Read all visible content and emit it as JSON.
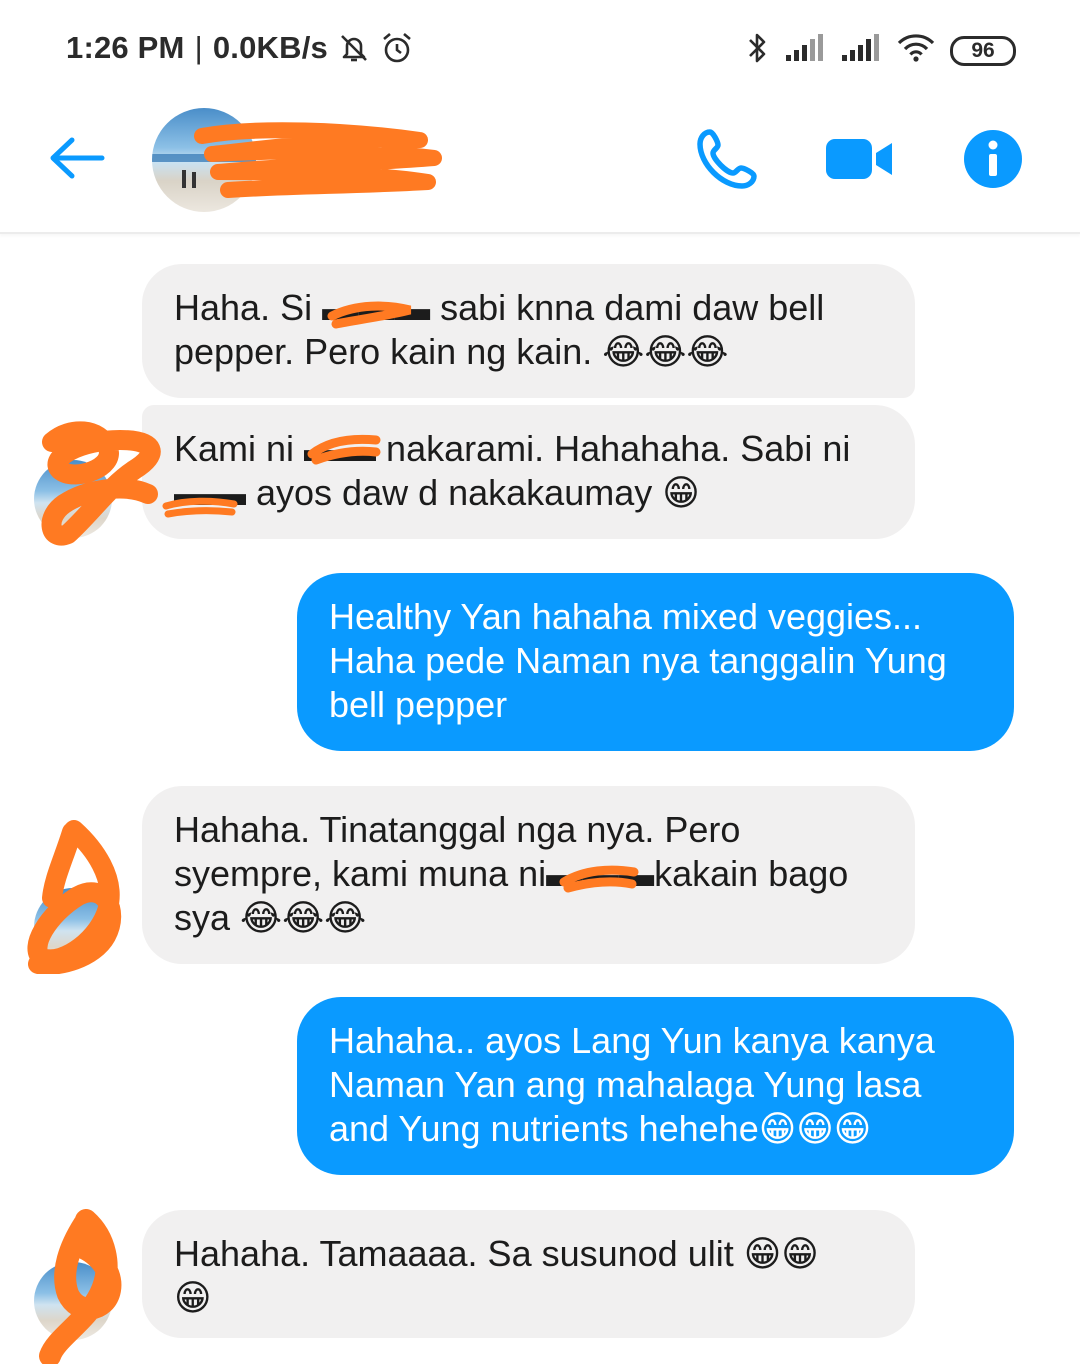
{
  "status_bar": {
    "time": "1:26 PM",
    "separator": "|",
    "network_speed": "0.0KB/s",
    "battery": "96",
    "icons": [
      "mute-bell-icon",
      "alarm-icon",
      "bluetooth-icon",
      "signal-icon",
      "signal-icon",
      "wifi-icon",
      "battery-icon"
    ]
  },
  "header": {
    "icons": [
      "back-arrow-icon",
      "phone-icon",
      "video-camera-icon",
      "info-icon"
    ],
    "accent_color": "#0a9aff"
  },
  "messages": [
    {
      "direction": "incoming",
      "lines": [
        "Haha. Si ▬▬▬ sabi knna dami daw bell",
        "pepper. Pero kain ng kain. 😂😂😂"
      ]
    },
    {
      "direction": "incoming",
      "lines": [
        "Kami ni ▬▬ nakarami. Hahahaha. Sabi ni",
        "▬▬ ayos daw d nakakaumay 😁"
      ]
    },
    {
      "direction": "outgoing",
      "lines": [
        "Healthy Yan hahaha mixed veggies...",
        "Haha pede Naman nya tanggalin Yung",
        "bell pepper"
      ]
    },
    {
      "direction": "incoming",
      "lines": [
        "Hahaha. Tinatanggal nga nya. Pero",
        "syempre, kami muna ni▬▬▬kakain bago",
        "sya 😂😂😂"
      ]
    },
    {
      "direction": "outgoing",
      "lines": [
        "Hahaha.. ayos Lang Yun kanya kanya",
        "Naman Yan ang mahalaga Yung lasa",
        "and Yung nutrients hehehe😁😁😁"
      ]
    },
    {
      "direction": "incoming",
      "lines": [
        "Hahaha. Tamaaaa. Sa susunod ulit 😁😁",
        "😁"
      ]
    }
  ],
  "colors": {
    "incoming_bubble": "#f1f0f0",
    "outgoing_bubble": "#0a9aff",
    "redaction": "#ff7a22"
  }
}
